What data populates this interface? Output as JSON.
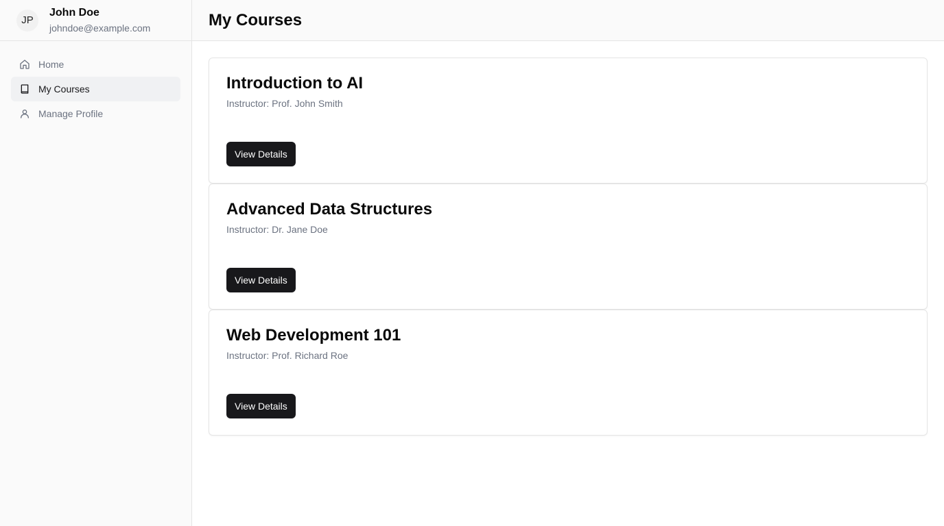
{
  "user": {
    "initials": "JP",
    "name": "John Doe",
    "email": "johndoe@example.com"
  },
  "sidebar": {
    "items": [
      {
        "label": "Home",
        "icon": "home-icon",
        "active": false
      },
      {
        "label": "My Courses",
        "icon": "book-icon",
        "active": true
      },
      {
        "label": "Manage Profile",
        "icon": "user-icon",
        "active": false
      }
    ]
  },
  "header": {
    "title": "My Courses"
  },
  "courses": [
    {
      "title": "Introduction to AI",
      "instructor": "Instructor: Prof. John Smith",
      "button": "View Details"
    },
    {
      "title": "Advanced Data Structures",
      "instructor": "Instructor: Dr. Jane Doe",
      "button": "View Details"
    },
    {
      "title": "Web Development 101",
      "instructor": "Instructor: Prof. Richard Roe",
      "button": "View Details"
    }
  ],
  "colors": {
    "accent": "#18181b",
    "muted_text": "#6b7280",
    "active_bg": "#f0f1f3",
    "border": "#e5e5e5"
  }
}
